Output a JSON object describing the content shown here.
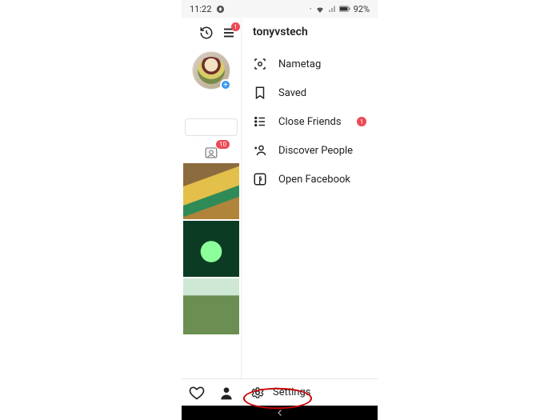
{
  "statusbar": {
    "time": "11:22",
    "battery_text": "92%"
  },
  "topbar": {
    "menu_badge": "1"
  },
  "drawer": {
    "username": "tonyvstech",
    "items": [
      {
        "icon": "nametag-icon",
        "label": "Nametag"
      },
      {
        "icon": "bookmark-icon",
        "label": "Saved"
      },
      {
        "icon": "list-icon",
        "label": "Close Friends",
        "badge": "1"
      },
      {
        "icon": "add-person-icon",
        "label": "Discover People"
      },
      {
        "icon": "facebook-icon",
        "label": "Open Facebook"
      }
    ]
  },
  "tagged_badge": "10",
  "bottom": {
    "settings_label": "Settings"
  }
}
